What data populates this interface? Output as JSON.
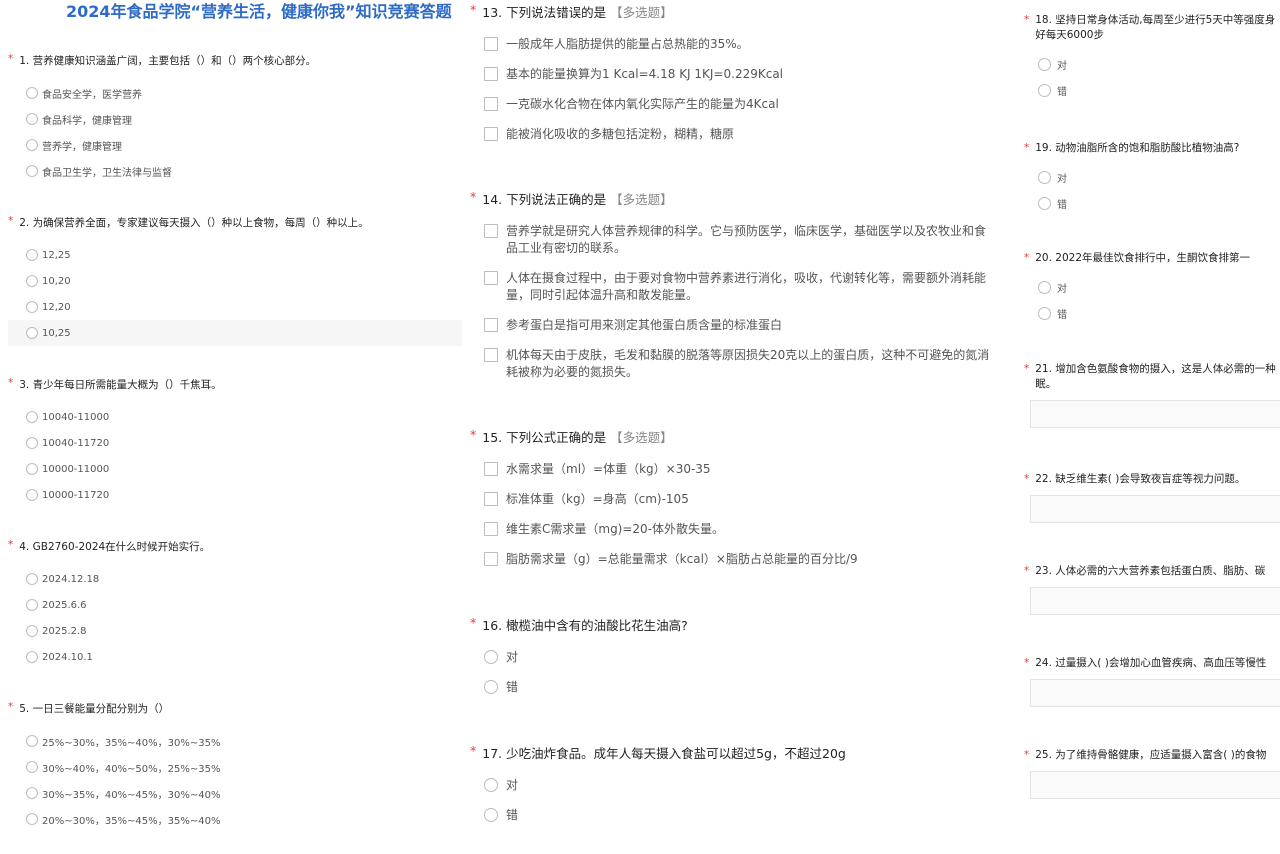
{
  "title": "2024年食品学院“营养生活，健康你我”知识竞赛答题",
  "required_mark": "*",
  "col1": {
    "questions": [
      {
        "text": "1. 营养健康知识涵盖广阔，主要包括（）和（）两个核心部分。",
        "options": [
          "食品安全学，医学营养",
          "食品科学，健康管理",
          "营养学，健康管理",
          "食品卫生学，卫生法律与监督"
        ]
      },
      {
        "text": "2. 为确保营养全面，专家建议每天摄入（）种以上食物，每周（）种以上。",
        "options": [
          "12,25",
          "10,20",
          "12,20",
          "10,25"
        ]
      },
      {
        "text": "3. 青少年每日所需能量大概为（）千焦耳。",
        "options": [
          "10040-11000",
          "10040-11720",
          "10000-11000",
          "10000-11720"
        ]
      },
      {
        "text": "4. GB2760-2024在什么时候开始实行。",
        "options": [
          "2024.12.18",
          "2025.6.6",
          "2025.2.8",
          "2024.10.1"
        ]
      },
      {
        "text": "5. 一日三餐能量分配分别为（）",
        "options": [
          "25%~30%，35%~40%，30%~35%",
          "30%~40%，40%~50%，25%~35%",
          "30%~35%，40%~45%，30%~40%",
          "20%~30%，35%~45%，35%~40%"
        ]
      }
    ]
  },
  "col2": {
    "questions": [
      {
        "text": "13. 下列说法错误的是",
        "tag": "【多选题】",
        "options": [
          "一般成年人脂肪提供的能量占总热能的35%。",
          "基本的能量换算为1 Kcal=4.18 KJ 1KJ=0.229Kcal",
          "一克碳水化合物在体内氧化实际产生的能量为4Kcal",
          "能被消化吸收的多糖包括淀粉，糊精，糖原"
        ]
      },
      {
        "text": "14. 下列说法正确的是",
        "tag": "【多选题】",
        "options": [
          "营养学就是研究人体营养规律的科学。它与预防医学，临床医学，基础医学以及农牧业和食品工业有密切的联系。",
          "人体在摄食过程中，由于要对食物中营养素进行消化，吸收，代谢转化等，需要额外消耗能量，同时引起体温升高和散发能量。",
          "参考蛋白是指可用来测定其他蛋白质含量的标准蛋白",
          "机体每天由于皮肤，毛发和黏膜的脱落等原因损失20克以上的蛋白质，这种不可避免的氮消耗被称为必要的氮损失。"
        ]
      },
      {
        "text": "15. 下列公式正确的是",
        "tag": "【多选题】",
        "options": [
          "水需求量（ml）=体重（kg）×30-35",
          "标准体重（kg）=身高（cm)-105",
          "维生素C需求量（mg)=20-体外散失量。",
          "脂肪需求量（g）=总能量需求（kcal）×脂肪占总能量的百分比/9"
        ]
      },
      {
        "text": "16. 橄榄油中含有的油酸比花生油高?",
        "options": [
          "对",
          "错"
        ]
      },
      {
        "text": "17. 少吃油炸食品。成年人每天摄入食盐可以超过5g，不超过20g",
        "options": [
          "对",
          "错"
        ]
      }
    ]
  },
  "col3": {
    "questions": [
      {
        "text_lines": [
          "18. 坚持日常身体活动,每周至少进行5天中等强度身",
          "好每天6000步"
        ],
        "options": [
          "对",
          "错"
        ]
      },
      {
        "text_lines": [
          "19. 动物油脂所含的饱和脂肪酸比植物油高?"
        ],
        "options": [
          "对",
          "错"
        ]
      },
      {
        "text_lines": [
          "20. 2022年最佳饮食排行中，生酮饮食排第一"
        ],
        "options": [
          "对",
          "错"
        ]
      },
      {
        "text_lines": [
          "21. 增加含色氨酸食物的摄入，这是人体必需的一种",
          "眠。"
        ],
        "options": []
      },
      {
        "text_lines": [
          "22. 缺乏维生素(   )会导致夜盲症等视力问题。"
        ],
        "options": []
      },
      {
        "text_lines": [
          "23. 人体必需的六大营养素包括蛋白质、脂肪、碳"
        ],
        "options": []
      },
      {
        "text_lines": [
          "24. 过量摄入(   )会增加心血管疾病、高血压等慢性"
        ],
        "options": []
      },
      {
        "text_lines": [
          "25. 为了维持骨骼健康，应适量摄入富含(   )的食物"
        ],
        "options": []
      }
    ]
  }
}
